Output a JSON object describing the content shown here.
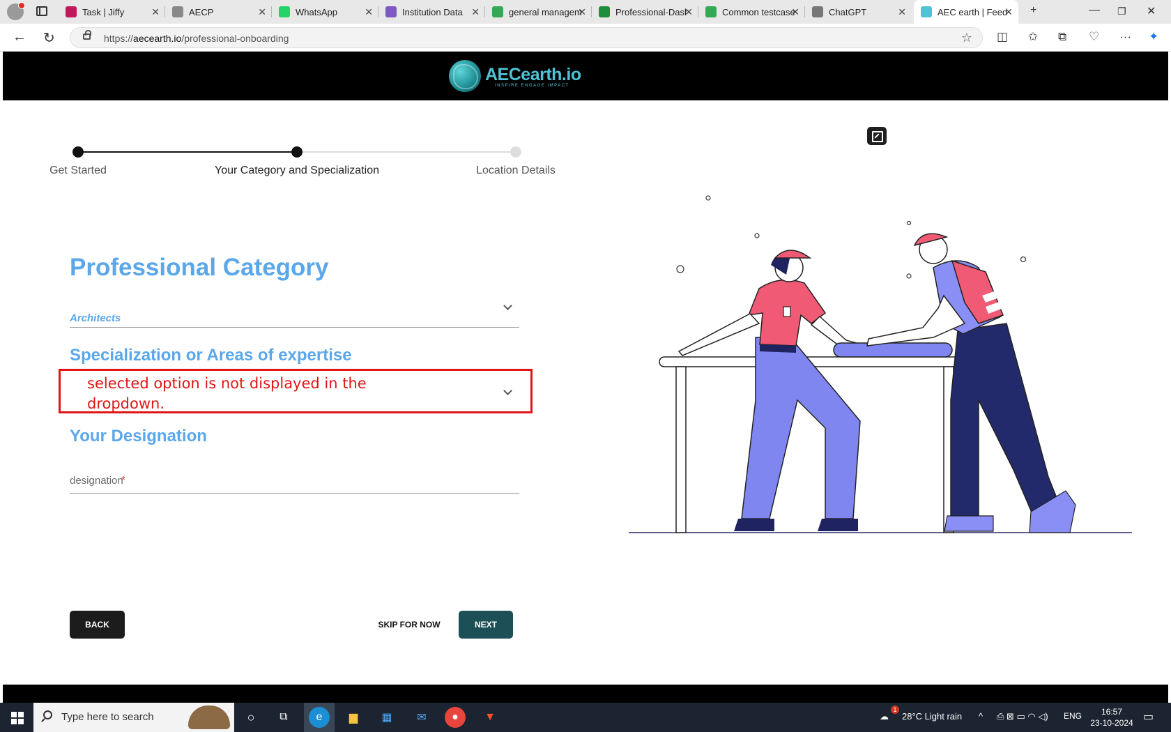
{
  "browser": {
    "tabs": [
      {
        "title": "Task | Jiffy",
        "icon": "jiffy-icon",
        "color": "#c2185b"
      },
      {
        "title": "AECP",
        "icon": "page-icon",
        "color": "#888888"
      },
      {
        "title": "WhatsApp",
        "icon": "whatsapp-icon",
        "color": "#25d366"
      },
      {
        "title": "Institution Data",
        "icon": "infinity-icon",
        "color": "#7e57c2"
      },
      {
        "title": "general managem",
        "icon": "sheets-icon",
        "color": "#34a853"
      },
      {
        "title": "Professional-Dash",
        "icon": "sheets-icon",
        "color": "#1e8e3e"
      },
      {
        "title": "Common testcase",
        "icon": "sheets-icon",
        "color": "#34a853"
      },
      {
        "title": "ChatGPT",
        "icon": "chatgpt-icon",
        "color": "#777777"
      },
      {
        "title": "AEC earth | Feed",
        "icon": "aec-icon",
        "color": "#4ec3d6"
      }
    ],
    "url_host": "aecearth.io",
    "url_prefix": "https://",
    "url_path": "/professional-onboarding"
  },
  "site": {
    "logo_main_a": "AEC",
    "logo_main_b": "earth.io",
    "logo_tagline": "INSPIRE ENGAGE IMPACT"
  },
  "stepper": {
    "steps": [
      {
        "label": "Get Started",
        "state": "done"
      },
      {
        "label": "Your Category and Specialization",
        "state": "current"
      },
      {
        "label": "Location Details",
        "state": "pending"
      }
    ]
  },
  "form": {
    "category_heading": "Professional Category",
    "category_value": "Architects",
    "specialization_heading": "Specialization or Areas of expertise",
    "specialization_annotation": "selected option is not displayed in the dropdown.",
    "designation_heading": "Your Designation",
    "designation_placeholder": "designation",
    "required_mark": "*"
  },
  "actions": {
    "back": "BACK",
    "skip": "SKIP FOR NOW",
    "next": "NEXT"
  },
  "taskbar": {
    "search_placeholder": "Type here to search",
    "weather": "28°C  Light rain",
    "language": "ENG",
    "time": "16:57",
    "date": "23-10-2024",
    "notification_count": "1"
  },
  "colors": {
    "accent": "#5aa7ea",
    "next_button": "#1d4f57",
    "annotation": "#e01515"
  }
}
